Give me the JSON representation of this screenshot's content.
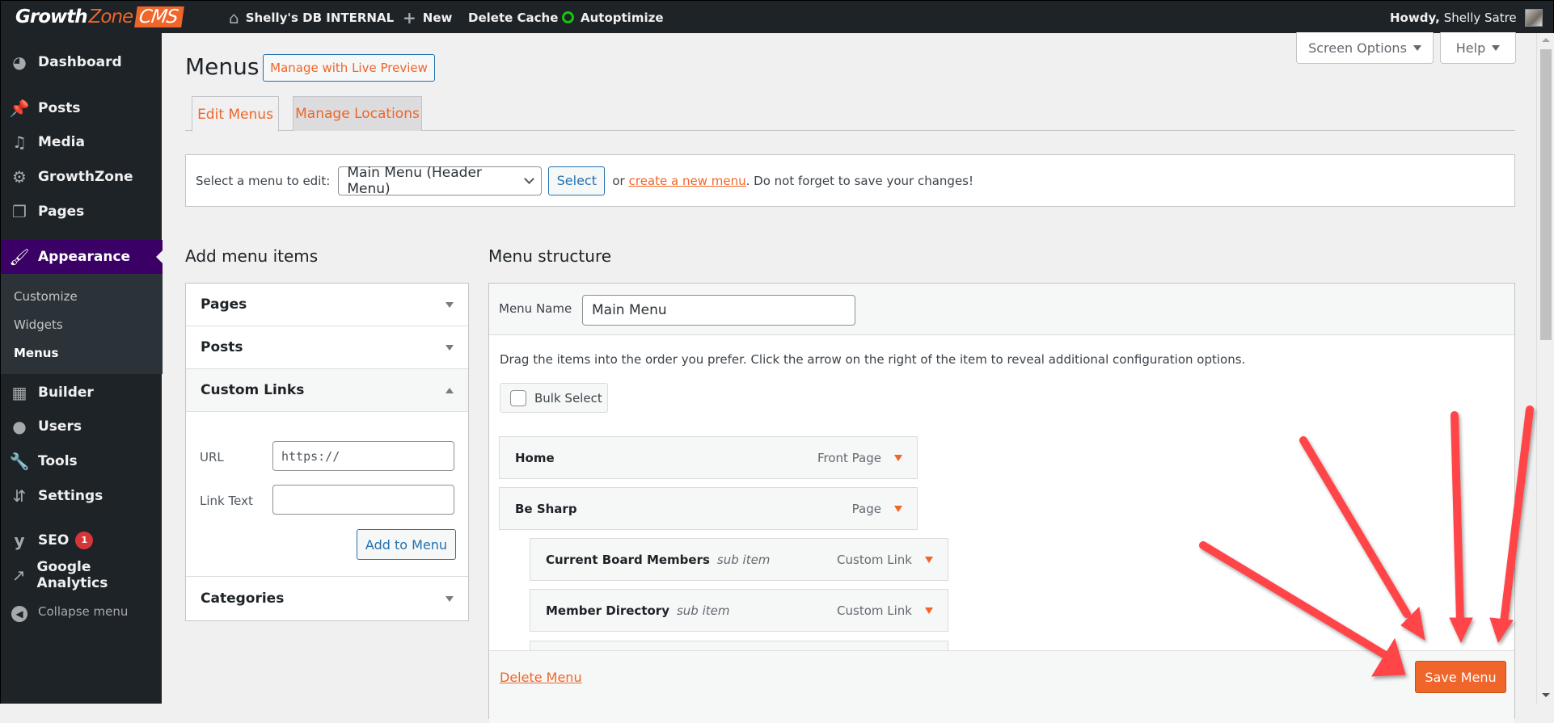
{
  "adminbar": {
    "logo": {
      "part1": "Growth",
      "part2": "Zone",
      "part3": "CMS"
    },
    "site_name": "Shelly's DB INTERNAL",
    "new_label": "New",
    "delete_cache_label": "Delete Cache",
    "autoptimize_label": "Autoptimize",
    "howdy_prefix": "Howdy,",
    "user_name": "Shelly Satre"
  },
  "sidebar": {
    "items": [
      {
        "label": "Dashboard",
        "icon": "dashboard-icon"
      },
      {
        "label": "Posts",
        "icon": "pin-icon"
      },
      {
        "label": "Media",
        "icon": "media-icon"
      },
      {
        "label": "GrowthZone",
        "icon": "gear-icon"
      },
      {
        "label": "Pages",
        "icon": "pages-icon"
      },
      {
        "label": "Appearance",
        "icon": "paintbrush-icon",
        "active": true
      },
      {
        "label": "Builder",
        "icon": "builder-icon"
      },
      {
        "label": "Users",
        "icon": "user-icon"
      },
      {
        "label": "Tools",
        "icon": "wrench-icon"
      },
      {
        "label": "Settings",
        "icon": "settings-icon"
      },
      {
        "label": "SEO",
        "icon": "yoast-icon",
        "badge": "1"
      },
      {
        "label": "Google Analytics",
        "icon": "analytics-icon"
      }
    ],
    "submenu": [
      "Customize",
      "Widgets",
      "Menus"
    ],
    "collapse_label": "Collapse menu"
  },
  "screen_meta": {
    "screen_options": "Screen Options",
    "help": "Help"
  },
  "page": {
    "title": "Menus",
    "live_preview_button": "Manage with Live Preview",
    "tabs": [
      {
        "label": "Edit Menus",
        "active": true
      },
      {
        "label": "Manage Locations",
        "active": false
      }
    ],
    "select_bar": {
      "label": "Select a menu to edit:",
      "selected_menu": "Main Menu (Header Menu)",
      "select_button": "Select",
      "or_text": "or",
      "create_link": "create a new menu",
      "reminder": ". Do not forget to save your changes!"
    }
  },
  "add_items": {
    "heading": "Add menu items",
    "sections": [
      "Pages",
      "Posts",
      "Custom Links",
      "Categories"
    ],
    "custom_links": {
      "url_label": "URL",
      "url_value": "https://",
      "link_text_label": "Link Text",
      "link_text_value": "",
      "add_button": "Add to Menu"
    }
  },
  "structure": {
    "heading": "Menu structure",
    "menu_name_label": "Menu Name",
    "menu_name_value": "Main Menu",
    "instructions": "Drag the items into the order you prefer. Click the arrow on the right of the item to reveal additional configuration options.",
    "bulk_select": "Bulk Select",
    "items": [
      {
        "title": "Home",
        "sub": "",
        "type": "Front Page",
        "depth": 0
      },
      {
        "title": "Be Sharp",
        "sub": "",
        "type": "Page",
        "depth": 0
      },
      {
        "title": "Current Board Members",
        "sub": "sub item",
        "type": "Custom Link",
        "depth": 1
      },
      {
        "title": "Member Directory",
        "sub": "sub item",
        "type": "Custom Link",
        "depth": 1
      }
    ],
    "delete_link": "Delete Menu",
    "save_button": "Save Menu"
  },
  "colors": {
    "accent": "#f06529",
    "admin_bar": "#1d2327",
    "active_menu": "#3a0066",
    "annotation_arrow": "#ff4447"
  }
}
